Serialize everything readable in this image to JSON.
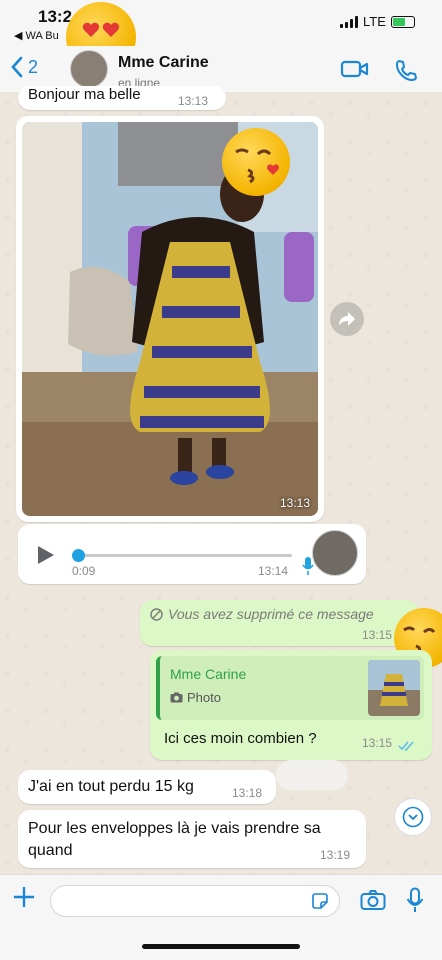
{
  "status": {
    "time": "13:2",
    "back_app": "WA Bu",
    "network": "LTE"
  },
  "header": {
    "back_count": "2",
    "contact_name": "Mme Carine",
    "contact_status": "en ligne"
  },
  "messages": [
    {
      "text": "Bonjour ma belle",
      "time": "13:13"
    },
    {
      "type": "photo",
      "time": "13:13"
    },
    {
      "type": "voice",
      "duration": "0:09",
      "time": "13:14"
    },
    {
      "text": "Vous avez supprimé ce message",
      "time": "13:15"
    },
    {
      "quote_author": "Mme Carine",
      "quote_label": "Photo",
      "text": "Ici ces moin combien ?",
      "time": "13:15"
    },
    {
      "text": "J'ai en tout perdu 15 kg",
      "time": "13:18"
    },
    {
      "text": "Pour les enveloppes là je vais prendre sa quand",
      "time": "13:19"
    }
  ],
  "icons": {
    "back": "chevron-left",
    "video": "video-camera",
    "call": "phone",
    "forward": "share-arrow",
    "play": "play-triangle",
    "mic": "microphone",
    "deleted": "no-entry",
    "camera_small": "camera",
    "ticks": "double-check",
    "scroll": "chevron-down",
    "add": "plus",
    "sticker": "sticker",
    "camera": "camera"
  },
  "colors": {
    "accent": "#1b86d4",
    "outgoing": "#dcf8c6",
    "incoming": "#ffffff",
    "quote_bar": "#30a24a",
    "read_ticks": "#53bdeb"
  }
}
